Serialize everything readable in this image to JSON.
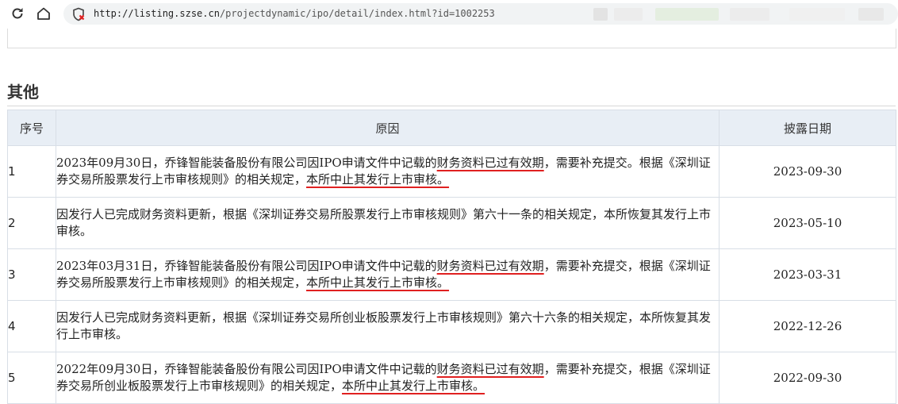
{
  "browser": {
    "url_host": "http://listing.szse.cn",
    "url_path": "/projectdynamic/ipo/detail/index.html?id=1002253",
    "icons": [
      "reload-icon",
      "home-icon",
      "not-secure-icon"
    ]
  },
  "section": {
    "title": "其他"
  },
  "table": {
    "headers": {
      "num": "序号",
      "reason": "原因",
      "date": "披露日期"
    },
    "rows": [
      {
        "num": "1",
        "r_a": "2023年09月30日，乔锋智能装备股份有限公司因IPO申请文件中记载的",
        "r_b": "财务资料已过有效期",
        "r_c": "，需要补充提交。根据《深圳证券交易所股票发行上市审核规则》的相关规定，",
        "r_d": "本所中止其发行上市审核。",
        "date": "2023-09-30"
      },
      {
        "num": "2",
        "reason": "因发行人已完成财务资料更新，根据《深圳证券交易所股票发行上市审核规则》第六十一条的相关规定，本所恢复其发行上市审核。",
        "date": "2023-05-10"
      },
      {
        "num": "3",
        "r_a": "2023年03月31日，乔锋智能装备股份有限公司因IPO申请文件中记载的",
        "r_b": "财务资料已过有效期",
        "r_c": "，需要补充提交，根据《深圳证券交易所股票发行上市审核规则》的相关规定，",
        "r_d": "本所中止其发行上市审核。",
        "date": "2023-03-31"
      },
      {
        "num": "4",
        "reason": "因发行人已完成财务资料更新，根据《深圳证券交易所创业板股票发行上市审核规则》第六十六条的相关规定，本所恢复其发行上市审核。",
        "date": "2022-12-26"
      },
      {
        "num": "5",
        "r_a": "2022年09月30日，乔锋智能装备股份有限公司因IPO申请文件中记载的",
        "r_b": "财务资料已过有效期",
        "r_c": "，需要补充提交，根据《深圳证券交易所创业板股票发行上市审核规则》的相关规定，",
        "r_d": "本所中止其发行上市审核。",
        "date": "2022-09-30"
      }
    ]
  },
  "colors": {
    "header_bg": "#e8eef5",
    "underline": "#e02020",
    "border": "#d8dee6"
  }
}
